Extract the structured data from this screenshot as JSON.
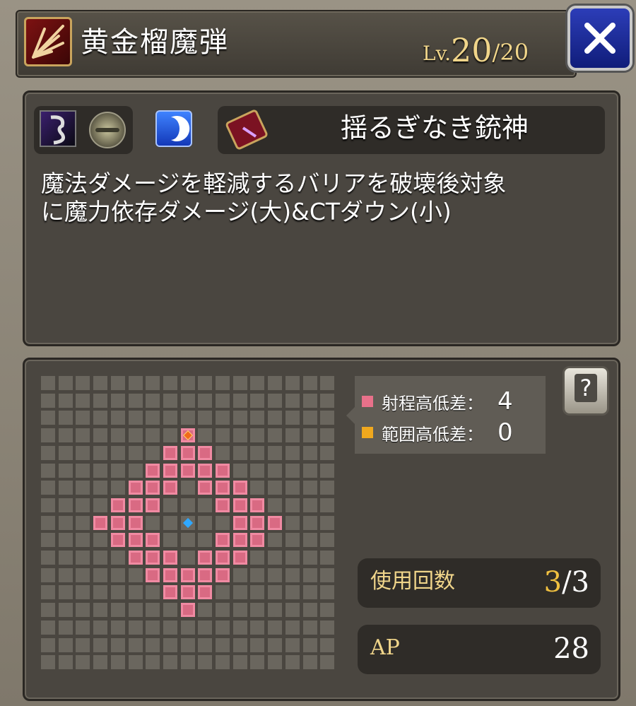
{
  "header": {
    "skill_name": "黄金榴魔弾",
    "level_prefix": "Lv.",
    "level_current": "20",
    "level_max": "/20",
    "icons": [
      "skill-category-icon",
      "close-icon"
    ]
  },
  "skill_info": {
    "attribute_icons": [
      "dark-element-icon",
      "gun-weapon-icon",
      "moon-icon"
    ],
    "job_icon": "spellbook-icon",
    "job_name": "揺るぎなき銃神",
    "description_line1": "魔法ダメージを軽減するバリアを破壊後対象",
    "description_line2": "に魔力依存ダメージ(大)&CTダウン(小)"
  },
  "range_map": {
    "grid_size": 17,
    "center": [
      8,
      8
    ],
    "target_marker": [
      8,
      3
    ],
    "legend": [
      {
        "label": "射程高低差：",
        "value": "4",
        "color": "#e8718a"
      },
      {
        "label": "範囲高低差：",
        "value": "0",
        "color": "#f0a81e"
      }
    ],
    "help_label": "?"
  },
  "stats": {
    "uses_label": "使用回数",
    "uses_current": "3",
    "uses_max": "/3",
    "ap_label": "AP",
    "ap_value": "28"
  },
  "colors": {
    "range_cell": "#e8718a",
    "empty_cell": "#6a665e",
    "level_text": "#f0d58a",
    "close_button": "#1a2aa0"
  }
}
